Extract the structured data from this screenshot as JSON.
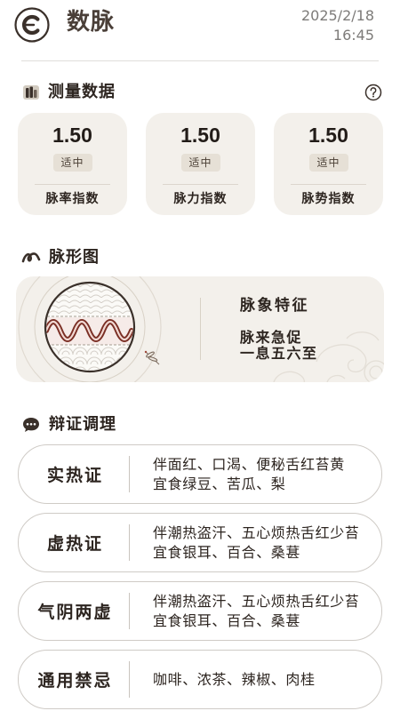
{
  "app": {
    "logo_icon": "logo-icon",
    "title": "数脉",
    "date": "2025/2/18",
    "time": "16:45"
  },
  "measurement": {
    "icon": "bar-chart-icon",
    "title": "测量数据",
    "help_icon": "help-circle-icon",
    "cards": [
      {
        "value": "1.50",
        "level": "适中",
        "label": "脉率指数"
      },
      {
        "value": "1.50",
        "level": "适中",
        "label": "脉力指数"
      },
      {
        "value": "1.50",
        "level": "适中",
        "label": "脉势指数"
      }
    ]
  },
  "pulse_shape": {
    "icon": "wave-icon",
    "title": "脉形图",
    "feature_title": "脉象特征",
    "feature_lines": [
      "脉来急促",
      "一息五六至"
    ]
  },
  "syndromes": {
    "icon": "chat-bubble-icon",
    "title": "辩证调理",
    "items": [
      {
        "name": "实热证",
        "lines": [
          "伴面红、口渴、便秘舌红苔黄",
          "宜食绿豆、苦瓜、梨"
        ]
      },
      {
        "name": "虚热证",
        "lines": [
          "伴潮热盗汗、五心烦热舌红少苔",
          "宜食银耳、百合、桑葚"
        ]
      },
      {
        "name": "气阴两虚",
        "lines": [
          "伴潮热盗汗、五心烦热舌红少苔",
          "宜食银耳、百合、桑葚"
        ]
      },
      {
        "name": "通用禁忌",
        "lines": [
          "咖啡、浓茶、辣椒、肉桂"
        ]
      }
    ]
  },
  "colors": {
    "background": "#ffffff",
    "text_primary": "#2d2520",
    "text_secondary": "#7d7b79",
    "title": "#4a3f38",
    "card_background": "#f3f0eb",
    "badge_background": "#e6e0d6",
    "row_border": "#cfcbc6",
    "pulse_wave": "#7b2f25"
  }
}
